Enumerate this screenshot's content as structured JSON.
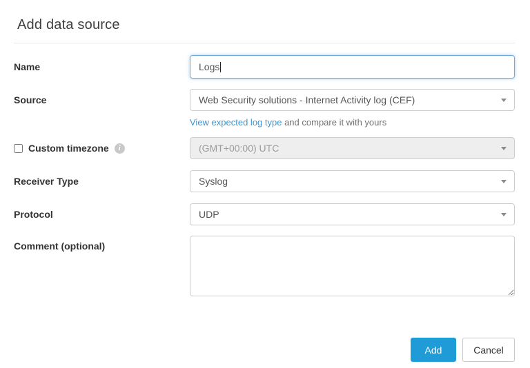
{
  "header": {
    "title": "Add data source"
  },
  "form": {
    "name": {
      "label": "Name",
      "value": "Logs",
      "focused": true
    },
    "source": {
      "label": "Source",
      "value": "Web Security solutions - Internet Activity log (CEF)",
      "link_label": "View expected log type",
      "link_suffix": " and compare it with yours"
    },
    "timezone": {
      "label": "Custom timezone",
      "checked": false,
      "value": "(GMT+00:00) UTC",
      "disabled": true
    },
    "receiver_type": {
      "label": "Receiver Type",
      "value": "Syslog"
    },
    "protocol": {
      "label": "Protocol",
      "value": "UDP"
    },
    "comment": {
      "label": "Comment (optional)",
      "value": ""
    }
  },
  "footer": {
    "add_label": "Add",
    "cancel_label": "Cancel"
  },
  "colors": {
    "accent": "#1f9bd8",
    "link": "#3a95d3",
    "focus_border": "#6aace0",
    "disabled_bg": "#eeeeee"
  }
}
